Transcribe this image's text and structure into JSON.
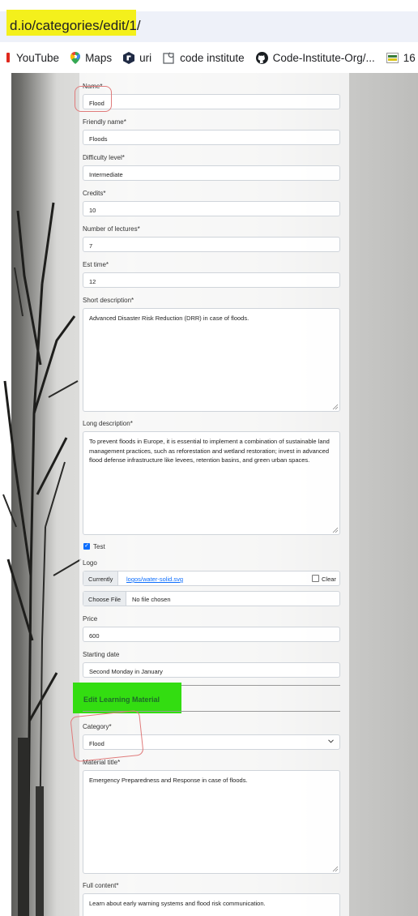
{
  "browser": {
    "url": "d.io/categories/edit/1/",
    "bookmarks": [
      {
        "label": "YouTube",
        "icon": "youtube-icon"
      },
      {
        "label": "Maps",
        "icon": "maps-pin-icon"
      },
      {
        "label": "uri",
        "icon": "hexagon-icon"
      },
      {
        "label": "code institute",
        "icon": "page-icon"
      },
      {
        "label": "Code-Institute-Org/...",
        "icon": "github-icon"
      },
      {
        "label": "16",
        "icon": "tab-group-icon"
      }
    ]
  },
  "form": {
    "name": {
      "label": "Name*",
      "value": "Flood"
    },
    "friendly_name": {
      "label": "Friendly name*",
      "value": "Floods"
    },
    "difficulty": {
      "label": "Difficulty level*",
      "value": "Intermediate"
    },
    "credits": {
      "label": "Credits*",
      "value": "10"
    },
    "lectures": {
      "label": "Number of lectures*",
      "value": "7"
    },
    "est_time": {
      "label": "Est time*",
      "value": "12"
    },
    "short_description": {
      "label": "Short description*",
      "value": "Advanced Disaster Risk Reduction (DRR) in case of floods."
    },
    "long_description": {
      "label": "Long description*",
      "value": "To prevent floods in Europe, it is essential to implement a combination of sustainable land management practices, such as reforestation and wetland restoration; invest in advanced flood defense infrastructure like levees, retention basins, and green urban spaces."
    },
    "test": {
      "label": "Test",
      "checked": true
    },
    "logo": {
      "label": "Logo",
      "currently_label": "Currently",
      "current_file": "logos/water-solid.svg",
      "clear_label": "Clear",
      "choose_label": "Choose File",
      "no_file": "No file chosen"
    },
    "price": {
      "label": "Price",
      "value": "600"
    },
    "starting_date": {
      "label": "Starting date",
      "value": "Second Monday in January"
    }
  },
  "learning_material": {
    "section_title": "Edit Learning Material",
    "category": {
      "label": "Category*",
      "value": "Flood"
    },
    "material_title": {
      "label": "Material title*",
      "value": "Emergency Preparedness and Response in case of floods."
    },
    "full_content": {
      "label": "Full content*",
      "value": "Learn about early warning systems and flood risk communication."
    }
  },
  "colors": {
    "url_highlight": "#f4f01c",
    "section_highlight": "#33dd11",
    "annotation_red": "#e07b7b",
    "checkbox_blue": "#0d6efd"
  }
}
